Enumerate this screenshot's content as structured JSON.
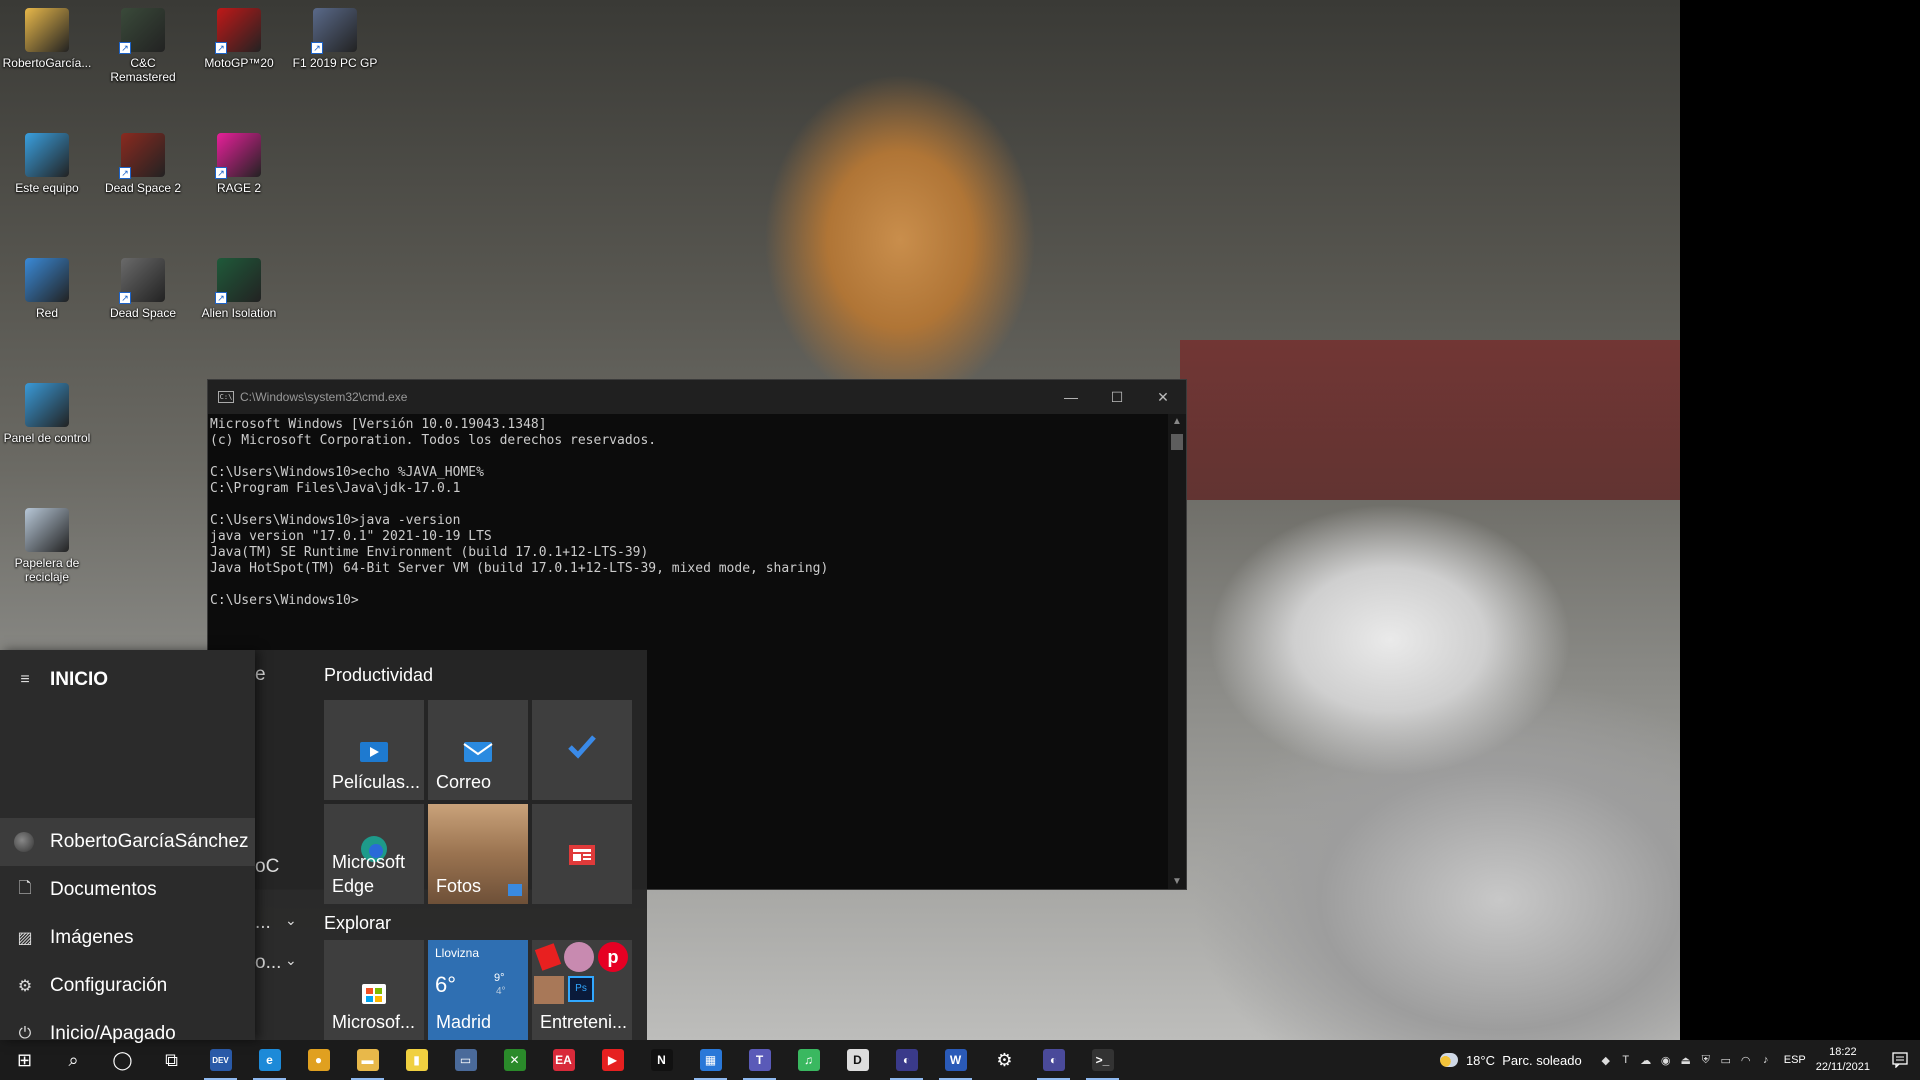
{
  "desktop": {
    "icons": [
      {
        "label": "RobertoGarcía...",
        "icon": "user-folder-icon",
        "color": "#e8b84a"
      },
      {
        "label": "C&C Remastered",
        "icon": "cnc-game-icon",
        "color": "#3a4a3a"
      },
      {
        "label": "MotoGP™20",
        "icon": "motogp-game-icon",
        "color": "#c01818"
      },
      {
        "label": "F1 2019 PC GP",
        "icon": "f1-game-icon",
        "color": "#5a6a8a"
      },
      {
        "label": "Este equipo",
        "icon": "this-pc-icon",
        "color": "#3aa0e0"
      },
      {
        "label": "Dead Space 2",
        "icon": "deadspace2-game-icon",
        "color": "#8a2a20"
      },
      {
        "label": "RAGE 2",
        "icon": "rage2-game-icon",
        "color": "#e8209a"
      },
      {
        "label": "Red",
        "icon": "network-icon",
        "color": "#3a8ad8"
      },
      {
        "label": "Dead Space",
        "icon": "deadspace-game-icon",
        "color": "#6a6a6a"
      },
      {
        "label": "Alien Isolation",
        "icon": "alien-game-icon",
        "color": "#1f5a3a"
      },
      {
        "label": "Panel de control",
        "icon": "control-panel-icon",
        "color": "#3a9ad8"
      },
      {
        "label": "Papelera de reciclaje",
        "icon": "recycle-bin-icon",
        "color": "#b8c8d8"
      }
    ]
  },
  "cmd": {
    "title": "C:\\Windows\\system32\\cmd.exe",
    "controls": {
      "minimize": "—",
      "maximize": "☐",
      "close": "✕"
    },
    "lines": [
      "Microsoft Windows [Versión 10.0.19043.1348]",
      "(c) Microsoft Corporation. Todos los derechos reservados.",
      "",
      "C:\\Users\\Windows10>echo %JAVA_HOME%",
      "C:\\Program Files\\Java\\jdk-17.0.1",
      "",
      "C:\\Users\\Windows10>java -version",
      "java version \"17.0.1\" 2021-10-19 LTS",
      "Java(TM) SE Runtime Environment (build 17.0.1+12-LTS-39)",
      "Java HotSpot(TM) 64-Bit Server VM (build 17.0.1+12-LTS-39, mixed mode, sharing)",
      "",
      "C:\\Users\\Windows10>"
    ]
  },
  "start": {
    "header": "INICIO",
    "nav": {
      "user": "RobertoGarcíaSánchez",
      "documents": "Documentos",
      "pictures": "Imágenes",
      "settings": "Configuración",
      "power": "Inicio/Apagado"
    },
    "applist_fragments": {
      "a": "e",
      "b": "oC",
      "c": "...",
      "d": "o..."
    },
    "groups": {
      "productivity": "Productividad",
      "explore": "Explorar"
    },
    "tiles": {
      "movies": "Películas...",
      "mail": "Correo",
      "todo": "",
      "edge": "Microsoft Edge",
      "photos": "Fotos",
      "news": "",
      "store": "Microsof...",
      "entertainment": "Entreteni..."
    },
    "weather_tile": {
      "condition": "Llovizna",
      "temp": "6°",
      "high": "9°",
      "low": "4°",
      "city": "Madrid"
    }
  },
  "taskbar": {
    "apps": [
      {
        "name": "start-button",
        "icon": "windows-icon",
        "glyph": "⊞",
        "color": "transparent"
      },
      {
        "name": "search-button",
        "icon": "search-icon",
        "glyph": "⌕",
        "color": "transparent"
      },
      {
        "name": "cortana-button",
        "icon": "cortana-icon",
        "glyph": "◯",
        "color": "transparent"
      },
      {
        "name": "task-view-button",
        "icon": "task-view-icon",
        "glyph": "⧉",
        "color": "transparent"
      },
      {
        "name": "devcpp-app",
        "icon": "devcpp-icon",
        "glyph": "DEV",
        "color": "#2a5aa8"
      },
      {
        "name": "edge-app",
        "icon": "edge-icon",
        "glyph": "e",
        "color": "#1d8ad8"
      },
      {
        "name": "chrome-app",
        "icon": "chrome-icon",
        "glyph": "●",
        "color": "#e0a020"
      },
      {
        "name": "file-explorer-app",
        "icon": "folder-icon",
        "glyph": "▬",
        "color": "#e8b84a"
      },
      {
        "name": "sticky-app",
        "icon": "notes-icon",
        "glyph": "▮",
        "color": "#f0d040"
      },
      {
        "name": "game-app",
        "icon": "gamepad-icon",
        "glyph": "▭",
        "color": "#4a6a9a"
      },
      {
        "name": "xbox-app",
        "icon": "xbox-icon",
        "glyph": "✕",
        "color": "#2a8a2a"
      },
      {
        "name": "ea-app",
        "icon": "ea-icon",
        "glyph": "EA",
        "color": "#d82a3a"
      },
      {
        "name": "youtube-app",
        "icon": "youtube-icon",
        "glyph": "▶",
        "color": "#e62020"
      },
      {
        "name": "netflix-app",
        "icon": "netflix-icon",
        "glyph": "N",
        "color": "#111111"
      },
      {
        "name": "trello-app",
        "icon": "trello-icon",
        "glyph": "▦",
        "color": "#2a78d8"
      },
      {
        "name": "teams-app",
        "icon": "teams-icon",
        "glyph": "T",
        "color": "#5a5ab8"
      },
      {
        "name": "spotify-app",
        "icon": "spotify-icon",
        "glyph": "♫",
        "color": "#3ab860"
      },
      {
        "name": "editor-app",
        "icon": "editor-icon",
        "glyph": "D",
        "color": "#dddddd"
      },
      {
        "name": "eclipse-app",
        "icon": "eclipse-icon",
        "glyph": "◐",
        "color": "#3a3a8a"
      },
      {
        "name": "word-app",
        "icon": "word-icon",
        "glyph": "W",
        "color": "#2a5ab8"
      },
      {
        "name": "settings-app",
        "icon": "gear-icon",
        "glyph": "⚙",
        "color": "transparent"
      },
      {
        "name": "eclipse2-app",
        "icon": "eclipse-icon",
        "glyph": "◐",
        "color": "#4a4a9a"
      },
      {
        "name": "cmd-app",
        "icon": "terminal-icon",
        "glyph": ">_",
        "color": "#333333"
      }
    ],
    "weather": {
      "temp": "18°C",
      "condition": "Parc. soleado"
    },
    "tray_icons": [
      "nvidia-icon",
      "teams-tray-icon",
      "onedrive-icon",
      "avast-icon",
      "usb-icon",
      "defender-icon",
      "battery-icon",
      "wifi-icon",
      "volume-icon"
    ],
    "language": "ESP",
    "time": "18:22",
    "date": "22/11/2021"
  }
}
